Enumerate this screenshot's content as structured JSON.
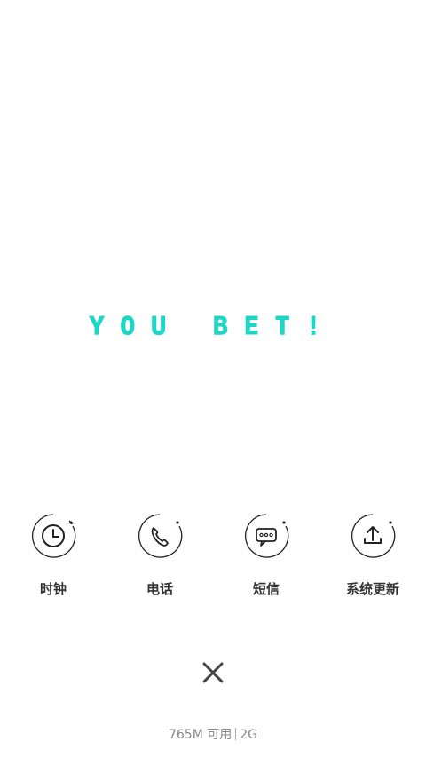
{
  "splash": {
    "text": "You bet!"
  },
  "apps": [
    {
      "label": "时钟",
      "icon": "clock-icon"
    },
    {
      "label": "电话",
      "icon": "phone-icon"
    },
    {
      "label": "短信",
      "icon": "message-icon"
    },
    {
      "label": "系统更新",
      "icon": "upload-icon"
    }
  ],
  "footer": {
    "memory": "765M 可用",
    "network": "2G"
  },
  "colors": {
    "accent": "#1fd6c6",
    "icon_stroke": "#222222"
  }
}
